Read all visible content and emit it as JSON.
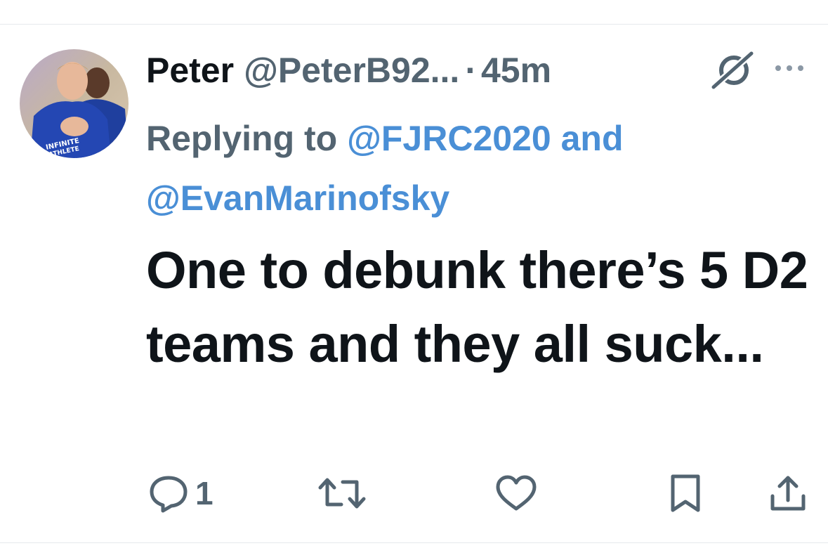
{
  "tweet": {
    "display_name": "Peter",
    "handle": "@PeterB92...",
    "separator": "·",
    "time": "45m",
    "reply": {
      "prefix": "Replying to",
      "mention_1": "@FJRC2020",
      "conjunction": "and",
      "mention_2": "@EvanMarinofsky"
    },
    "text": "One to debunk there’s 5 D2 teams and they all suck..."
  },
  "actions": {
    "reply_count": "1"
  },
  "icons": {
    "grok": "grok-icon",
    "more": "more-icon",
    "reply": "reply-icon",
    "retweet": "retweet-icon",
    "like": "heart-icon",
    "bookmark": "bookmark-icon",
    "share": "share-icon"
  },
  "colors": {
    "primary_text": "#0f1419",
    "secondary_text": "#536471",
    "mention": "#4a8fd6"
  }
}
